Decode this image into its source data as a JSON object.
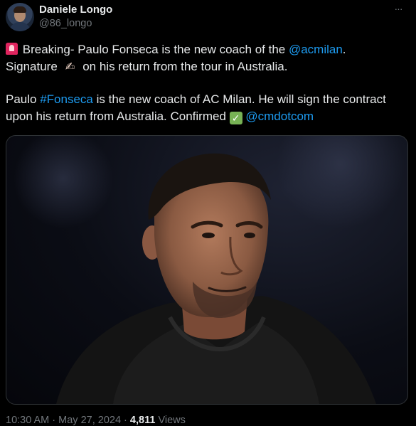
{
  "author": {
    "display_name": "Daniele Longo",
    "handle": "@86_longo"
  },
  "more_label": "···",
  "tweet": {
    "line1_text_a": "Breaking- Paulo Fonseca is the new coach of the ",
    "line1_mention": "@acmilan",
    "line1_text_b": ".",
    "line2_text_a": "Signature ",
    "line2_text_b": " on his return from the tour in Australia.",
    "line3_text_a": "Paulo ",
    "line3_hashtag": "#Fonseca",
    "line3_text_b": " is the new coach of AC Milan. He will sign the contract",
    "line4_text_a": "upon his return from Australia. Confirmed ",
    "line4_mention": "@cmdotcom",
    "emoji_check": "✓",
    "emoji_writing": "✍"
  },
  "meta": {
    "time": "10:30 AM",
    "separator": " · ",
    "date": "May 27, 2024",
    "views_count": "4,811",
    "views_label": " Views"
  },
  "icons": {
    "siren": "rotating-light-icon",
    "check": "check-mark-button-icon",
    "writing": "writing-hand-icon",
    "more": "more-horizontal-icon"
  },
  "colors": {
    "background": "#000000",
    "text": "#e7e9ea",
    "secondary": "#71767b",
    "link": "#1d9bf0"
  }
}
